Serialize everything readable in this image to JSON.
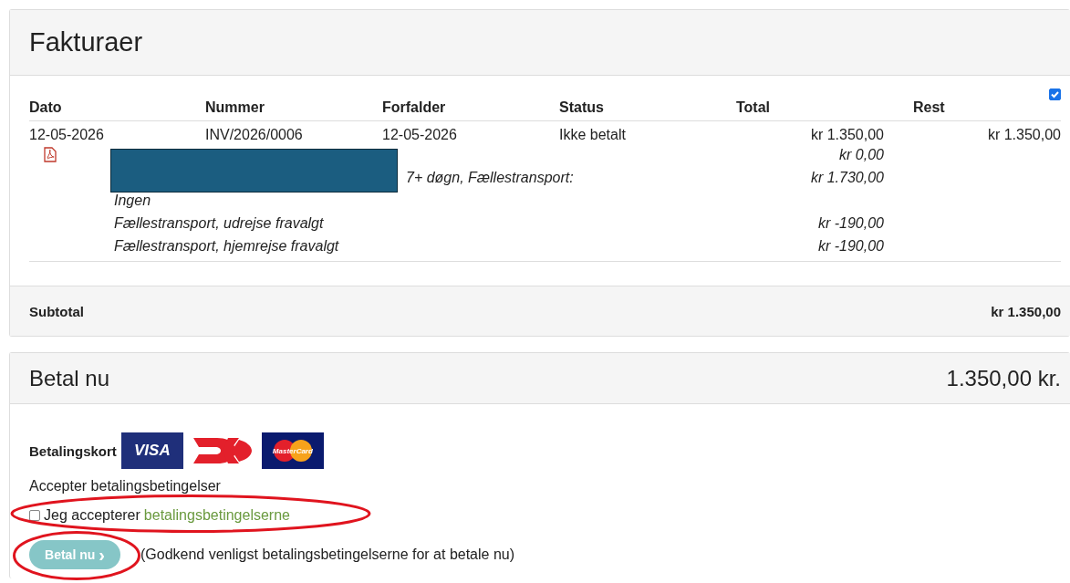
{
  "invoices": {
    "title": "Fakturaer",
    "columns": [
      "Dato",
      "Nummer",
      "Forfalder",
      "Status",
      "Total",
      "Rest"
    ],
    "select_all_checked": true,
    "rows": [
      {
        "cells": [
          "12-05-2026",
          "INV/2026/0006",
          "12-05-2026",
          "Ikke betalt",
          "kr 1.350,00",
          "kr 1.350,00"
        ],
        "lines": [
          {
            "kind": "pdf",
            "amount": "kr 0,00"
          },
          {
            "kind": "redacted",
            "description": "7+ døgn, Fællestransport:",
            "amount": "kr 1.730,00"
          },
          {
            "kind": "text",
            "description": "Ingen"
          },
          {
            "kind": "text",
            "description": "Fællestransport, udrejse fravalgt",
            "amount": "kr -190,00"
          },
          {
            "kind": "text",
            "description": "Fællestransport, hjemrejse fravalgt",
            "amount": "kr -190,00"
          }
        ]
      }
    ],
    "subtotal": {
      "label": "Subtotal",
      "value": "kr 1.350,00"
    }
  },
  "payment": {
    "title": "Betal nu",
    "amount": "1.350,00 kr.",
    "cards_label": "Betalingskort",
    "cards": [
      {
        "kind": "visa",
        "text": "VISA"
      },
      {
        "kind": "dankort"
      },
      {
        "kind": "mastercard",
        "text": "MasterCard"
      }
    ],
    "terms_heading": "Accepter betalingsbetingelser",
    "accept_checked": false,
    "accept_text": "Jeg accepterer",
    "accept_link": "betalingsbetingelserne",
    "pay_button": {
      "label": "Betal nu",
      "icon": "›",
      "disabled": true
    },
    "note": "(Godkend venligst betalingsbetingelserne for at betale nu)"
  }
}
